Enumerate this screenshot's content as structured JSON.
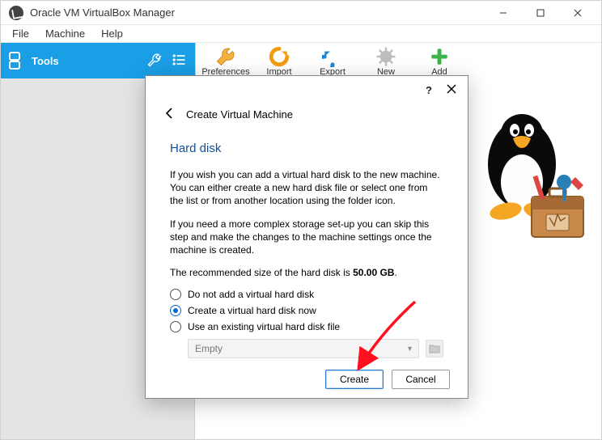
{
  "window": {
    "title": "Oracle VM VirtualBox Manager"
  },
  "menu": {
    "file": "File",
    "machine": "Machine",
    "help": "Help"
  },
  "tools_tab": {
    "label": "Tools"
  },
  "toolbar": {
    "preferences": "Preferences",
    "import": "Import",
    "export": "Export",
    "new": "New",
    "add": "Add"
  },
  "dialog": {
    "help_symbol": "?",
    "title": "Create Virtual Machine",
    "section": "Hard disk",
    "para1": "If you wish you can add a virtual hard disk to the new machine. You can either create a new hard disk file or select one from the list or from another location using the folder icon.",
    "para2": "If you need a more complex storage set-up you can skip this step and make the changes to the machine settings once the machine is created.",
    "para3_prefix": "The recommended size of the hard disk is ",
    "para3_bold": "50.00 GB",
    "para3_suffix": ".",
    "opt_none": "Do not add a virtual hard disk",
    "opt_create": "Create a virtual hard disk now",
    "opt_existing": "Use an existing virtual hard disk file",
    "selected_option": "opt_create",
    "existing_value": "Empty",
    "create_btn": "Create",
    "cancel_btn": "Cancel"
  }
}
